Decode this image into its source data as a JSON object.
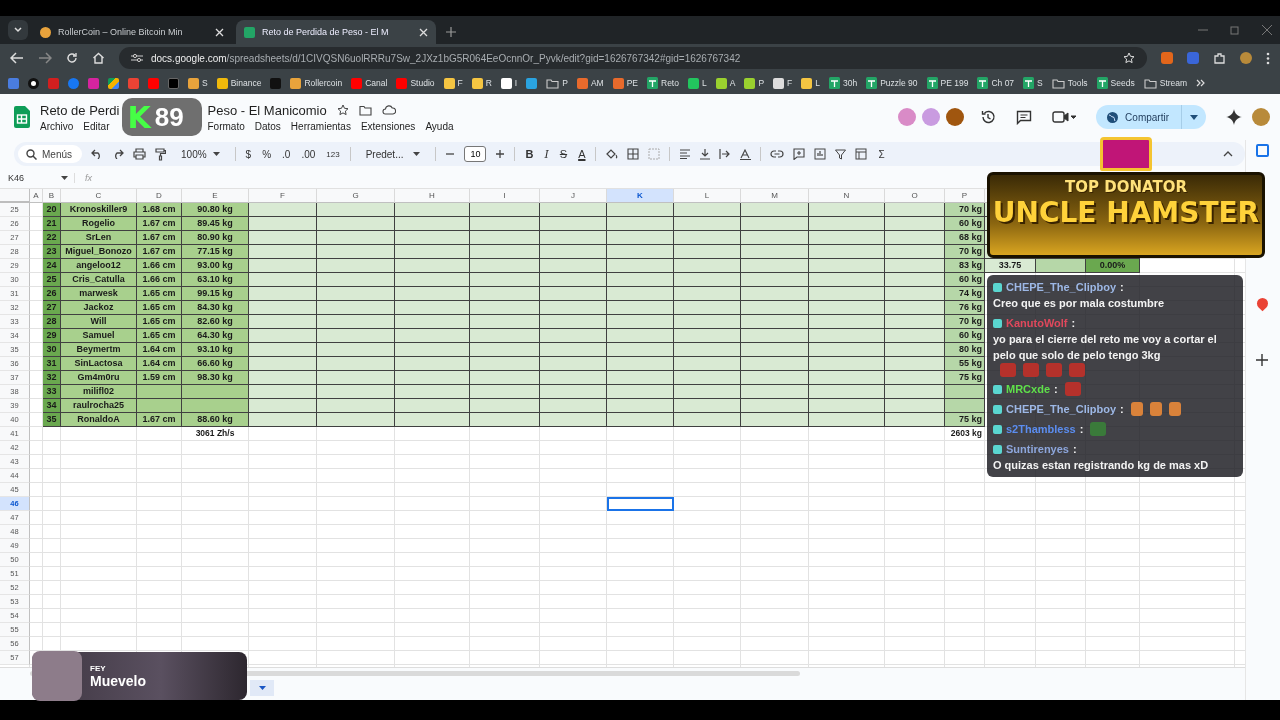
{
  "browser": {
    "tabs": [
      {
        "title": "RollerCoin – Online Bitcoin Min",
        "kind": "hamster",
        "selected": false
      },
      {
        "title": "Reto de Perdida de Peso - El M",
        "kind": "sheets",
        "selected": true
      }
    ],
    "url_host": "docs.google.com",
    "url_path": "/spreadsheets/d/1CIVQSN6uolRRRu7Sw_2JXz1bG5R064EeOcnnOr_Pyvk/edit?gid=1626767342#gid=1626767342",
    "bookmarks": [
      {
        "kind": "site",
        "color": "#e8a33c",
        "label": "S"
      },
      {
        "kind": "site",
        "color": "#f0b90b",
        "label": "Binance"
      },
      {
        "kind": "site",
        "color": "#111111"
      },
      {
        "kind": "site",
        "color": "#e8a33c",
        "label": "Rollercoin"
      },
      {
        "kind": "site",
        "color": "#ff0000",
        "label": "Canal"
      },
      {
        "kind": "site",
        "color": "#ff0000",
        "label": "Studio"
      },
      {
        "kind": "site",
        "color": "#f5c542",
        "label": "F"
      },
      {
        "kind": "site",
        "color": "#f5c542",
        "label": "R"
      },
      {
        "kind": "site",
        "color": "#ffffff",
        "label": "I"
      },
      {
        "kind": "site",
        "color": "#2aa3e0"
      },
      {
        "kind": "folder",
        "label": "P"
      },
      {
        "kind": "site",
        "color": "#e86a2c",
        "label": "AM"
      },
      {
        "kind": "site",
        "color": "#e86a2c",
        "label": "PE"
      },
      {
        "kind": "sheet",
        "label": "Reto"
      },
      {
        "kind": "site",
        "color": "#22c55e",
        "label": "L"
      },
      {
        "kind": "site",
        "color": "#9ad12f",
        "label": "A"
      },
      {
        "kind": "site",
        "color": "#9ad12f",
        "label": "P"
      },
      {
        "kind": "site",
        "color": "#dddddd",
        "label": "F"
      },
      {
        "kind": "site",
        "color": "#f5c542",
        "label": "L"
      },
      {
        "kind": "sheet",
        "label": "30h"
      },
      {
        "kind": "sheet",
        "label": "Puzzle 90"
      },
      {
        "kind": "sheet",
        "label": "PE 199"
      },
      {
        "kind": "sheet",
        "label": "Ch 07"
      },
      {
        "kind": "sheet",
        "label": "S"
      },
      {
        "kind": "folder",
        "label": "Tools"
      },
      {
        "kind": "sheet",
        "label": "Seeds"
      },
      {
        "kind": "folder",
        "label": "Stream"
      }
    ]
  },
  "doc": {
    "title_parts": [
      "Reto de Perdi",
      "Peso - El Manicomio"
    ],
    "menus_before_logo": [
      "Archivo",
      "Editar"
    ],
    "menus_after_logo": [
      "Formato",
      "Datos",
      "Herramientas",
      "Extensiones",
      "Ayuda"
    ],
    "collaborators": [
      {
        "color": "#d98bc7"
      },
      {
        "color": "#c99be0"
      },
      {
        "color": "#a0560f"
      }
    ],
    "share_label": "Compartir"
  },
  "toolbar": {
    "search_label": "Menús",
    "zoom": "100%",
    "currency": "$",
    "percent": "%",
    "decrease_decimals": ".0",
    "increase_decimals": ".00",
    "number_format": "123",
    "font": "Predet...",
    "font_size": "10",
    "style_buttons": [
      {
        "label": "B",
        "kind": "bold"
      },
      {
        "label": "I",
        "kind": "italic"
      },
      {
        "label": "S",
        "kind": "strike"
      },
      {
        "label": "A",
        "kind": "color"
      }
    ],
    "sum": "Σ"
  },
  "formula_bar": {
    "cell": "K46",
    "fx": "fx"
  },
  "sheet": {
    "columns": [
      {
        "label": "A",
        "selected": false
      },
      {
        "label": "B",
        "selected": false
      },
      {
        "label": "C",
        "selected": false
      },
      {
        "label": "D",
        "selected": false
      },
      {
        "label": "E",
        "selected": false
      },
      {
        "label": "F",
        "selected": false
      },
      {
        "label": "G",
        "selected": false
      },
      {
        "label": "H",
        "selected": false
      },
      {
        "label": "I",
        "selected": false
      },
      {
        "label": "J",
        "selected": false
      },
      {
        "label": "K",
        "selected": true
      },
      {
        "label": "L",
        "selected": false
      },
      {
        "label": "M",
        "selected": false
      },
      {
        "label": "N",
        "selected": false
      },
      {
        "label": "O",
        "selected": false
      },
      {
        "label": "P",
        "selected": false
      }
    ],
    "rows": [
      {
        "row": "25",
        "kind": "entry",
        "selected": false,
        "b": "20",
        "c": "Kronoskiller9",
        "d": "1.68 cm",
        "e": "90.80 kg",
        "p": "70 kg"
      },
      {
        "row": "26",
        "kind": "entry",
        "selected": false,
        "b": "21",
        "c": "Rogelio",
        "d": "1.67 cm",
        "e": "89.45 kg",
        "p": "60 kg"
      },
      {
        "row": "27",
        "kind": "entry",
        "selected": false,
        "b": "22",
        "c": "SrLen",
        "d": "1.67 cm",
        "e": "80.90 kg",
        "p": "68 kg"
      },
      {
        "row": "28",
        "kind": "entry",
        "selected": false,
        "b": "23",
        "c": "Miguel_Bonozo",
        "d": "1.67 cm",
        "e": "77.15 kg",
        "p": "70 kg"
      },
      {
        "row": "29",
        "kind": "entry",
        "selected": false,
        "b": "24",
        "c": "angeloo12",
        "d": "1.66 cm",
        "e": "93.00 kg",
        "p": "83 kg",
        "q": "33.75",
        "s": "0.00%"
      },
      {
        "row": "30",
        "kind": "entry",
        "selected": false,
        "b": "25",
        "c": "Cris_Catulla",
        "d": "1.66 cm",
        "e": "63.10 kg",
        "p": "60 kg"
      },
      {
        "row": "31",
        "kind": "entry",
        "selected": false,
        "b": "26",
        "c": "marwesk",
        "d": "1.65 cm",
        "e": "99.15 kg",
        "p": "74 kg"
      },
      {
        "row": "32",
        "kind": "entry",
        "selected": false,
        "b": "27",
        "c": "Jackoz",
        "d": "1.65 cm",
        "e": "84.30 kg",
        "p": "76 kg"
      },
      {
        "row": "33",
        "kind": "entry",
        "selected": false,
        "b": "28",
        "c": "Will",
        "d": "1.65 cm",
        "e": "82.60 kg",
        "p": "70 kg"
      },
      {
        "row": "34",
        "kind": "entry",
        "selected": false,
        "b": "29",
        "c": "Samuel",
        "d": "1.65 cm",
        "e": "64.30 kg",
        "p": "60 kg"
      },
      {
        "row": "35",
        "kind": "entry",
        "selected": false,
        "b": "30",
        "c": "Beymertm",
        "d": "1.64 cm",
        "e": "93.10 kg",
        "p": "80 kg"
      },
      {
        "row": "36",
        "kind": "entry",
        "selected": false,
        "b": "31",
        "c": "SinLactosa",
        "d": "1.64 cm",
        "e": "66.60 kg",
        "p": "55 kg"
      },
      {
        "row": "37",
        "kind": "entry",
        "selected": false,
        "b": "32",
        "c": "Gm4m0ru",
        "d": "1.59 cm",
        "e": "98.30 kg",
        "p": "75 kg"
      },
      {
        "row": "38",
        "kind": "entry",
        "selected": false,
        "b": "33",
        "c": "milifl02"
      },
      {
        "row": "39",
        "kind": "entry",
        "selected": false,
        "b": "34",
        "c": "raulrocha25"
      },
      {
        "row": "40",
        "kind": "entry",
        "selected": false,
        "b": "35",
        "c": "RonaldoA",
        "d": "1.67 cm",
        "e": "88.60 kg",
        "p": "75 kg"
      },
      {
        "row": "41",
        "kind": "total",
        "selected": false,
        "e": "3061 Zh/s",
        "p": "2603 kg"
      },
      {
        "row": "42",
        "kind": "empty",
        "selected": false
      },
      {
        "row": "43",
        "kind": "empty",
        "selected": false
      },
      {
        "row": "44",
        "kind": "empty",
        "selected": false
      },
      {
        "row": "45",
        "kind": "empty",
        "selected": false
      },
      {
        "row": "46",
        "kind": "empty",
        "selected": true
      },
      {
        "row": "47",
        "kind": "empty",
        "selected": false
      },
      {
        "row": "48",
        "kind": "empty",
        "selected": false
      },
      {
        "row": "49",
        "kind": "empty",
        "selected": false
      },
      {
        "row": "50",
        "kind": "empty",
        "selected": false
      },
      {
        "row": "51",
        "kind": "empty",
        "selected": false
      },
      {
        "row": "52",
        "kind": "empty",
        "selected": false
      },
      {
        "row": "53",
        "kind": "empty",
        "selected": false
      },
      {
        "row": "54",
        "kind": "empty",
        "selected": false
      },
      {
        "row": "55",
        "kind": "empty",
        "selected": false
      },
      {
        "row": "56",
        "kind": "empty",
        "selected": false
      },
      {
        "row": "57",
        "kind": "empty",
        "selected": false
      }
    ]
  },
  "overlay": {
    "logo_letter": "K",
    "logo_number": "89",
    "banner": {
      "subtitle": "TOP DONATOR",
      "name": "UNCLE HAMSTER"
    },
    "chat": [
      {
        "user": "CHEPE_The_Clipboy",
        "color": "#9db8e6",
        "separator": ":",
        "text": "Creo que es por mala costumbre"
      },
      {
        "user": "KanutoWolf",
        "color": "#e0485c",
        "separator": ":",
        "text": "yo para el cierre del reto me voy a cortar el pelo que solo de pelo tengo 3kg",
        "emotes": [
          {
            "kind": "face"
          },
          {
            "kind": "face"
          },
          {
            "kind": "face"
          },
          {
            "kind": "face"
          }
        ]
      },
      {
        "user": "MRCxde",
        "color": "#5fe04a",
        "separator": ":",
        "emotes": [
          {
            "kind": "face"
          }
        ]
      },
      {
        "user": "CHEPE_The_Clipboy",
        "color": "#9db8e6",
        "separator": ":",
        "emotes": [
          {
            "kind": "monkey"
          },
          {
            "kind": "monkey"
          },
          {
            "kind": "monkey"
          }
        ]
      },
      {
        "user": "s2Thambless",
        "color": "#5b8df0",
        "separator": ":",
        "emotes": [
          {
            "kind": "hat"
          }
        ]
      },
      {
        "user": "Suntirenyes",
        "color": "#8da6dc",
        "separator": ":",
        "text": "O quizas estan registrando kg de mas xD"
      }
    ],
    "music": {
      "artist": "FEY",
      "song": "Muevelo"
    }
  }
}
